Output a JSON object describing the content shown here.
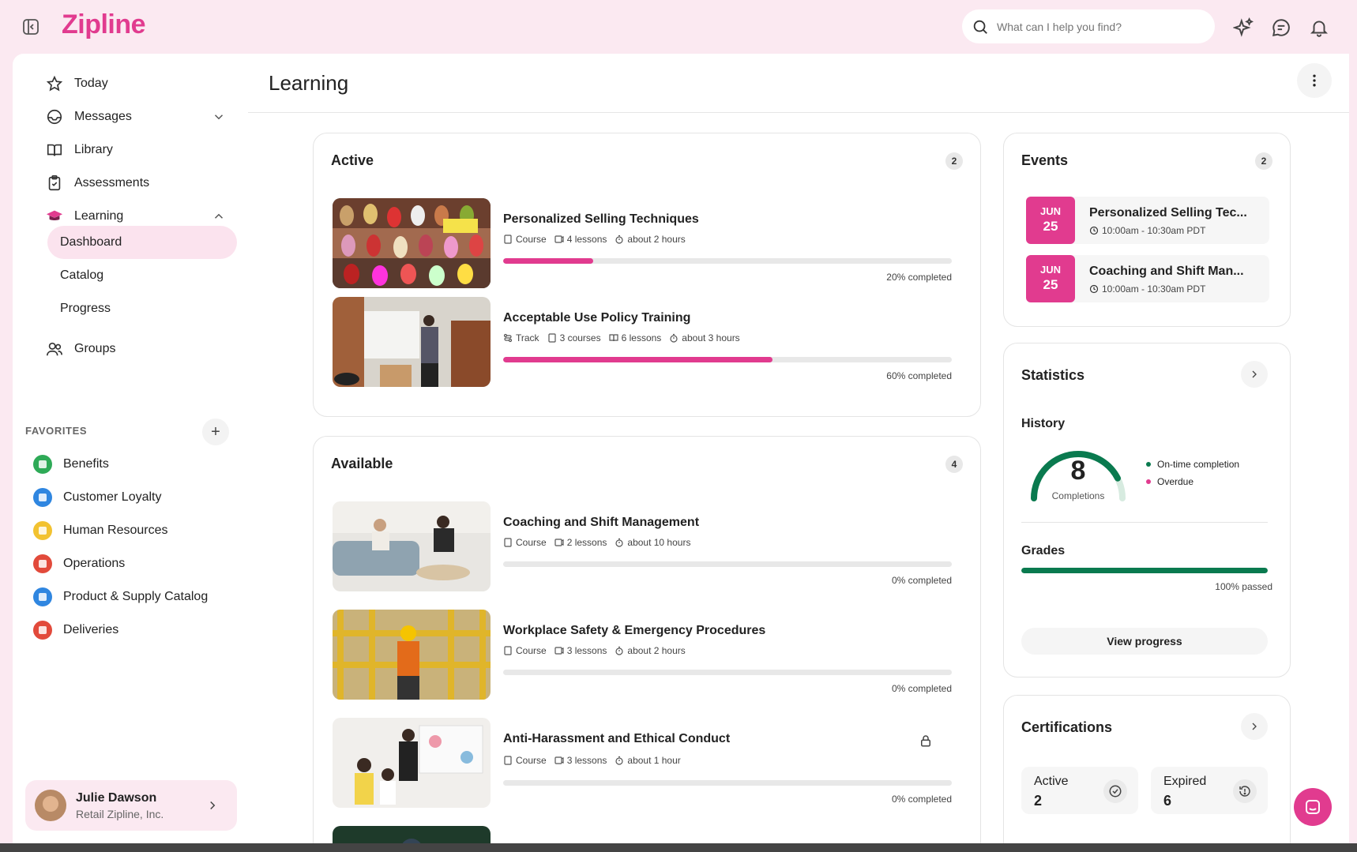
{
  "app": {
    "logo": "Zipline"
  },
  "search": {
    "placeholder": "What can I help you find?"
  },
  "nav": {
    "today": "Today",
    "messages": "Messages",
    "library": "Library",
    "assessments": "Assessments",
    "learning": "Learning",
    "dashboard": "Dashboard",
    "catalog": "Catalog",
    "progress": "Progress",
    "groups": "Groups"
  },
  "favorites": {
    "title": "FAVORITES",
    "add": "+",
    "items": [
      {
        "label": "Benefits",
        "color": "#2eaa57"
      },
      {
        "label": "Customer Loyalty",
        "color": "#2f86e0"
      },
      {
        "label": "Human Resources",
        "color": "#f2c230"
      },
      {
        "label": "Operations",
        "color": "#e24a3b"
      },
      {
        "label": "Product & Supply Catalog",
        "color": "#2f86e0"
      },
      {
        "label": "Deliveries",
        "color": "#e24a3b"
      }
    ]
  },
  "user": {
    "name": "Julie Dawson",
    "org": "Retail Zipline, Inc."
  },
  "page": {
    "title": "Learning"
  },
  "active": {
    "title": "Active",
    "count": "2",
    "courses": [
      {
        "title": "Personalized Selling Techniques",
        "meta": [
          "Course",
          "4 lessons",
          "about 2 hours"
        ],
        "progress": 20,
        "pct_label": "20% completed"
      },
      {
        "title": "Acceptable Use Policy Training",
        "meta": [
          "Track",
          "3 courses",
          "6 lessons",
          "about 3 hours"
        ],
        "progress": 60,
        "pct_label": "60% completed"
      }
    ]
  },
  "available": {
    "title": "Available",
    "count": "4",
    "courses": [
      {
        "title": "Coaching and Shift Management",
        "meta": [
          "Course",
          "2 lessons",
          "about 10 hours"
        ],
        "progress": 0,
        "pct_label": "0% completed"
      },
      {
        "title": "Workplace Safety & Emergency Procedures",
        "meta": [
          "Course",
          "3 lessons",
          "about 2 hours"
        ],
        "progress": 0,
        "pct_label": "0% completed"
      },
      {
        "title": "Anti-Harassment and Ethical Conduct",
        "meta": [
          "Course",
          "3 lessons",
          "about 1 hour"
        ],
        "progress": 0,
        "pct_label": "0% completed"
      }
    ]
  },
  "events": {
    "title": "Events",
    "count": "2",
    "items": [
      {
        "month": "JUN",
        "day": "25",
        "title": "Personalized Selling Tec...",
        "time": "10:00am - 10:30am PDT"
      },
      {
        "month": "JUN",
        "day": "25",
        "title": "Coaching and Shift Man...",
        "time": "10:00am - 10:30am PDT"
      }
    ]
  },
  "statistics": {
    "title": "Statistics",
    "history_label": "History",
    "completions": "8",
    "completions_label": "Completions",
    "on_time_share": 0.85,
    "legend": [
      {
        "label": "On-time completion",
        "color": "#0a7a4f"
      },
      {
        "label": "Overdue",
        "color": "#e13b8f"
      }
    ],
    "grades_label": "Grades",
    "grades_progress": 100,
    "grades_pct": "100% passed",
    "view_progress": "View progress"
  },
  "certifications": {
    "title": "Certifications",
    "active_label": "Active",
    "active_count": "2",
    "expired_label": "Expired",
    "expired_count": "6"
  },
  "colors": {
    "accent": "#e13b8f",
    "green": "#0a7a4f",
    "page_bg": "#fbe9f1"
  }
}
